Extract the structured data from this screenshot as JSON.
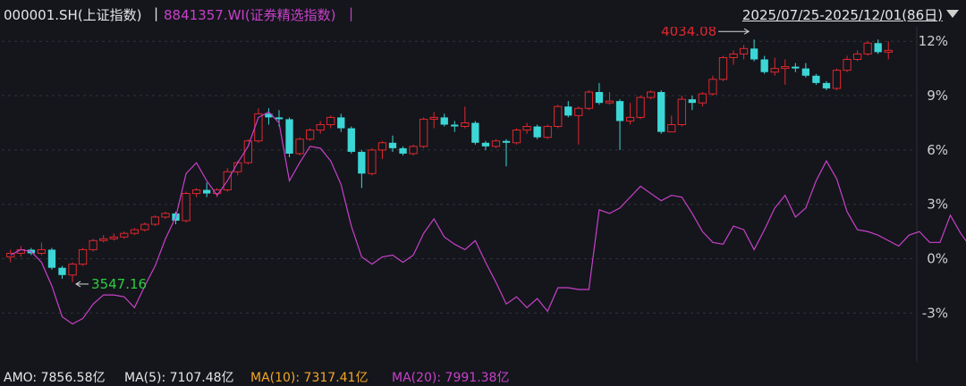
{
  "header": {
    "title_index": "000001.SH(上证指数)",
    "separator": "|",
    "title_compare": "8841357.WI(证券精选指数)",
    "date_range": "2025/07/25-2025/12/01(86日)"
  },
  "footer": {
    "amo": "AMO: 7856.58亿",
    "ma5": "MA(5): 7107.48亿",
    "ma10": "MA(10): 7317.41亿",
    "ma20": "MA(20): 7991.38亿"
  },
  "colors": {
    "up": "#e0282e",
    "down": "#3cd6d6",
    "compare_line": "#c940c9",
    "grid": "#30333b",
    "high_label": "#e0282e",
    "low_label": "#2ecc40",
    "ma10": "#f5a623",
    "ma20": "#c940c9"
  },
  "chart_data": {
    "type": "candlestick+line",
    "y_axis": {
      "ticks": [
        "12%",
        "9%",
        "6%",
        "3%",
        "0%",
        "-3%"
      ],
      "tick_values": [
        12,
        9,
        6,
        3,
        0,
        -3
      ],
      "ylim": [
        -5.2,
        12.8
      ]
    },
    "annotations": {
      "high": "4034.08",
      "low": "3547.16"
    },
    "candles": [
      [
        0.1,
        0.3,
        0.5,
        -0.2
      ],
      [
        0.3,
        0.5,
        0.7,
        0.1
      ],
      [
        0.5,
        0.3,
        0.6,
        0.2
      ],
      [
        0.3,
        0.5,
        0.9,
        0.2
      ],
      [
        0.5,
        -0.5,
        0.6,
        -0.6
      ],
      [
        -0.5,
        -0.9,
        -0.4,
        -1.1
      ],
      [
        -0.9,
        -0.3,
        -0.2,
        -1.3
      ],
      [
        -0.3,
        0.5,
        0.6,
        -0.4
      ],
      [
        0.5,
        1,
        1.1,
        0.4
      ],
      [
        1,
        1.1,
        1.3,
        0.9
      ],
      [
        1.1,
        1.2,
        1.4,
        1
      ],
      [
        1.2,
        1.4,
        1.5,
        1.1
      ],
      [
        1.4,
        1.6,
        1.7,
        1.3
      ],
      [
        1.6,
        1.9,
        2,
        1.5
      ],
      [
        1.9,
        2.3,
        2.4,
        1.8
      ],
      [
        2.3,
        2.5,
        2.6,
        2.2
      ],
      [
        2.5,
        2.1,
        2.6,
        1.9
      ],
      [
        2.1,
        3.6,
        3.7,
        2
      ],
      [
        3.6,
        3.8,
        3.9,
        3.4
      ],
      [
        3.8,
        3.6,
        4.2,
        3.4
      ],
      [
        3.6,
        3.8,
        3.9,
        3.4
      ],
      [
        3.8,
        4.8,
        5,
        3.7
      ],
      [
        4.8,
        5.3,
        5.4,
        4.6
      ],
      [
        5.3,
        6.5,
        6.6,
        5.2
      ],
      [
        6.5,
        8,
        8.3,
        6.4
      ],
      [
        8,
        7.8,
        8.3,
        7.4
      ],
      [
        7.8,
        7.7,
        8.2,
        7.3
      ],
      [
        7.7,
        5.8,
        7.8,
        5.6
      ],
      [
        5.8,
        6.6,
        6.7,
        5.7
      ],
      [
        6.6,
        7.1,
        7.2,
        6.5
      ],
      [
        7.1,
        7.4,
        7.6,
        6.9
      ],
      [
        7.4,
        7.8,
        7.9,
        7.2
      ],
      [
        7.8,
        7.2,
        8,
        7
      ],
      [
        7.2,
        5.9,
        7.3,
        5.8
      ],
      [
        5.9,
        4.7,
        6,
        3.9
      ],
      [
        4.7,
        6,
        6.1,
        4.6
      ],
      [
        6,
        6.4,
        6.5,
        5.5
      ],
      [
        6.4,
        6.1,
        6.8,
        5.9
      ],
      [
        6.1,
        5.8,
        6.2,
        5.7
      ],
      [
        5.8,
        6.2,
        6.3,
        5.7
      ],
      [
        6.2,
        7.7,
        7.8,
        6.1
      ],
      [
        7.7,
        7.8,
        8.1,
        7.2
      ],
      [
        7.8,
        7.4,
        8,
        7.3
      ],
      [
        7.4,
        7.3,
        7.6,
        7
      ],
      [
        7.3,
        7.5,
        8.4,
        7.2
      ],
      [
        7.5,
        6.4,
        7.6,
        6.3
      ],
      [
        6.4,
        6.2,
        6.5,
        6
      ],
      [
        6.2,
        6.5,
        6.6,
        6.1
      ],
      [
        6.5,
        6.4,
        6.6,
        5.1
      ],
      [
        6.4,
        7.1,
        7.2,
        6.3
      ],
      [
        7.1,
        7.3,
        7.5,
        6.9
      ],
      [
        7.3,
        6.7,
        7.4,
        6.6
      ],
      [
        6.7,
        7.3,
        7.4,
        6.6
      ],
      [
        7.3,
        8.4,
        8.5,
        7.2
      ],
      [
        8.4,
        7.9,
        8.7,
        7.8
      ],
      [
        7.9,
        8.3,
        8.4,
        6.3
      ],
      [
        8.3,
        9.2,
        9.3,
        8.2
      ],
      [
        9.2,
        8.6,
        9.7,
        8.5
      ],
      [
        8.6,
        8.7,
        9.2,
        8.5
      ],
      [
        8.7,
        7.6,
        8.8,
        6
      ],
      [
        7.6,
        7.8,
        8.6,
        7.4
      ],
      [
        7.8,
        8.9,
        9.0,
        7.7
      ],
      [
        8.9,
        9.2,
        9.3,
        8.8
      ],
      [
        9.2,
        7.0,
        9.3,
        6.9
      ],
      [
        7.0,
        7.4,
        7.9,
        7
      ],
      [
        7.4,
        8.8,
        9.0,
        7.3
      ],
      [
        8.8,
        8.6,
        9.0,
        8.2
      ],
      [
        8.6,
        9.1,
        9.2,
        8.4
      ],
      [
        9.1,
        9.9,
        10.1,
        9.0
      ],
      [
        9.9,
        11.1,
        11.2,
        9.8
      ],
      [
        11.1,
        11.3,
        11.5,
        10.7
      ],
      [
        11.3,
        11.6,
        11.8,
        11.0
      ],
      [
        11.6,
        11.0,
        12.1,
        10.9
      ],
      [
        11.0,
        10.3,
        11.2,
        10.2
      ],
      [
        10.3,
        10.5,
        11.1,
        10.1
      ],
      [
        10.5,
        10.6,
        11.0,
        9.6
      ],
      [
        10.6,
        10.5,
        10.8,
        10.3
      ],
      [
        10.5,
        10.1,
        10.8,
        10
      ],
      [
        10.1,
        9.7,
        10.2,
        9.6
      ],
      [
        9.7,
        9.4,
        9.8,
        9.3
      ],
      [
        9.4,
        10.4,
        10.5,
        9.3
      ],
      [
        10.4,
        11.0,
        11.2,
        10.3
      ],
      [
        11.0,
        11.3,
        11.5,
        10.9
      ],
      [
        11.3,
        11.9,
        12,
        11.2
      ],
      [
        11.9,
        11.4,
        12.1,
        11.3
      ],
      [
        11.4,
        11.5,
        12.0,
        11.0
      ]
    ],
    "compare_line": [
      0.2,
      0.5,
      0.4,
      -0.2,
      -1.5,
      -3.2,
      -3.6,
      -3.3,
      -2.5,
      -2.0,
      -2.0,
      -2.1,
      -2.7,
      -1.5,
      -0.4,
      1.1,
      2.3,
      4.7,
      5.3,
      4.3,
      3.5,
      4.3,
      5.3,
      6.2,
      7.8,
      8.1,
      7.5,
      4.3,
      5.3,
      6.2,
      6.1,
      5.4,
      4.1,
      1.8,
      0.1,
      -0.3,
      0.1,
      0.2,
      -0.2,
      0.2,
      1.4,
      2.2,
      1.2,
      0.8,
      0.5,
      1.0,
      -0.2,
      -1.3,
      -2.5,
      -2.1,
      -2.7,
      -2.2,
      -2.9,
      -1.6,
      -1.6,
      -1.7,
      -1.7,
      2.7,
      2.5,
      2.8,
      3.4,
      4.0,
      3.6,
      3.2,
      3.5,
      3.4,
      2.5,
      1.5,
      0.9,
      0.8,
      1.8,
      1.6,
      0.5,
      1.6,
      2.8,
      3.5,
      2.3,
      2.8,
      4.3,
      5.4,
      4.4,
      2.6,
      1.6,
      1.5,
      1.3,
      1.0,
      0.7,
      1.3,
      1.5,
      0.9,
      0.9,
      2.4,
      1.4,
      0.6
    ]
  }
}
